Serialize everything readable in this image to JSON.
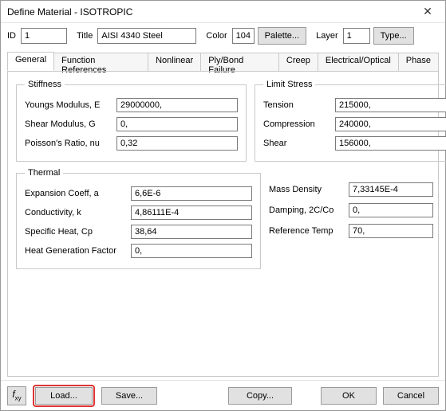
{
  "window": {
    "title": "Define Material - ISOTROPIC"
  },
  "top": {
    "id_label": "ID",
    "id": "1",
    "title_label": "Title",
    "title": "AISI 4340 Steel",
    "color_label": "Color",
    "color": "104",
    "palette": "Palette...",
    "layer_label": "Layer",
    "layer": "1",
    "type": "Type..."
  },
  "tabs": {
    "general": "General",
    "function": "Function References",
    "nonlinear": "Nonlinear",
    "plybond": "Ply/Bond Failure",
    "creep": "Creep",
    "electrical": "Electrical/Optical",
    "phase": "Phase"
  },
  "stiffness": {
    "legend": "Stiffness",
    "youngs_label": "Youngs Modulus, E",
    "youngs": "29000000,",
    "shear_label": "Shear Modulus, G",
    "shear": "0,",
    "poisson_label": "Poisson's Ratio, nu",
    "poisson": "0,32"
  },
  "limit": {
    "legend": "Limit Stress",
    "tension_label": "Tension",
    "tension": "215000,",
    "compression_label": "Compression",
    "compression": "240000,",
    "shear_label": "Shear",
    "shear": "156000,"
  },
  "thermal": {
    "legend": "Thermal",
    "expansion_label": "Expansion Coeff, a",
    "expansion": "6,6E-6",
    "conductivity_label": "Conductivity, k",
    "conductivity": "4,86111E-4",
    "specheat_label": "Specific Heat, Cp",
    "specheat": "38,64",
    "heatgen_label": "Heat Generation Factor",
    "heatgen": "0,"
  },
  "other": {
    "mass_label": "Mass Density",
    "mass": "7,33145E-4",
    "damping_label": "Damping, 2C/Co",
    "damping": "0,",
    "reftemp_label": "Reference Temp",
    "reftemp": "70,"
  },
  "footer": {
    "load": "Load...",
    "save": "Save...",
    "copy": "Copy...",
    "ok": "OK",
    "cancel": "Cancel"
  }
}
